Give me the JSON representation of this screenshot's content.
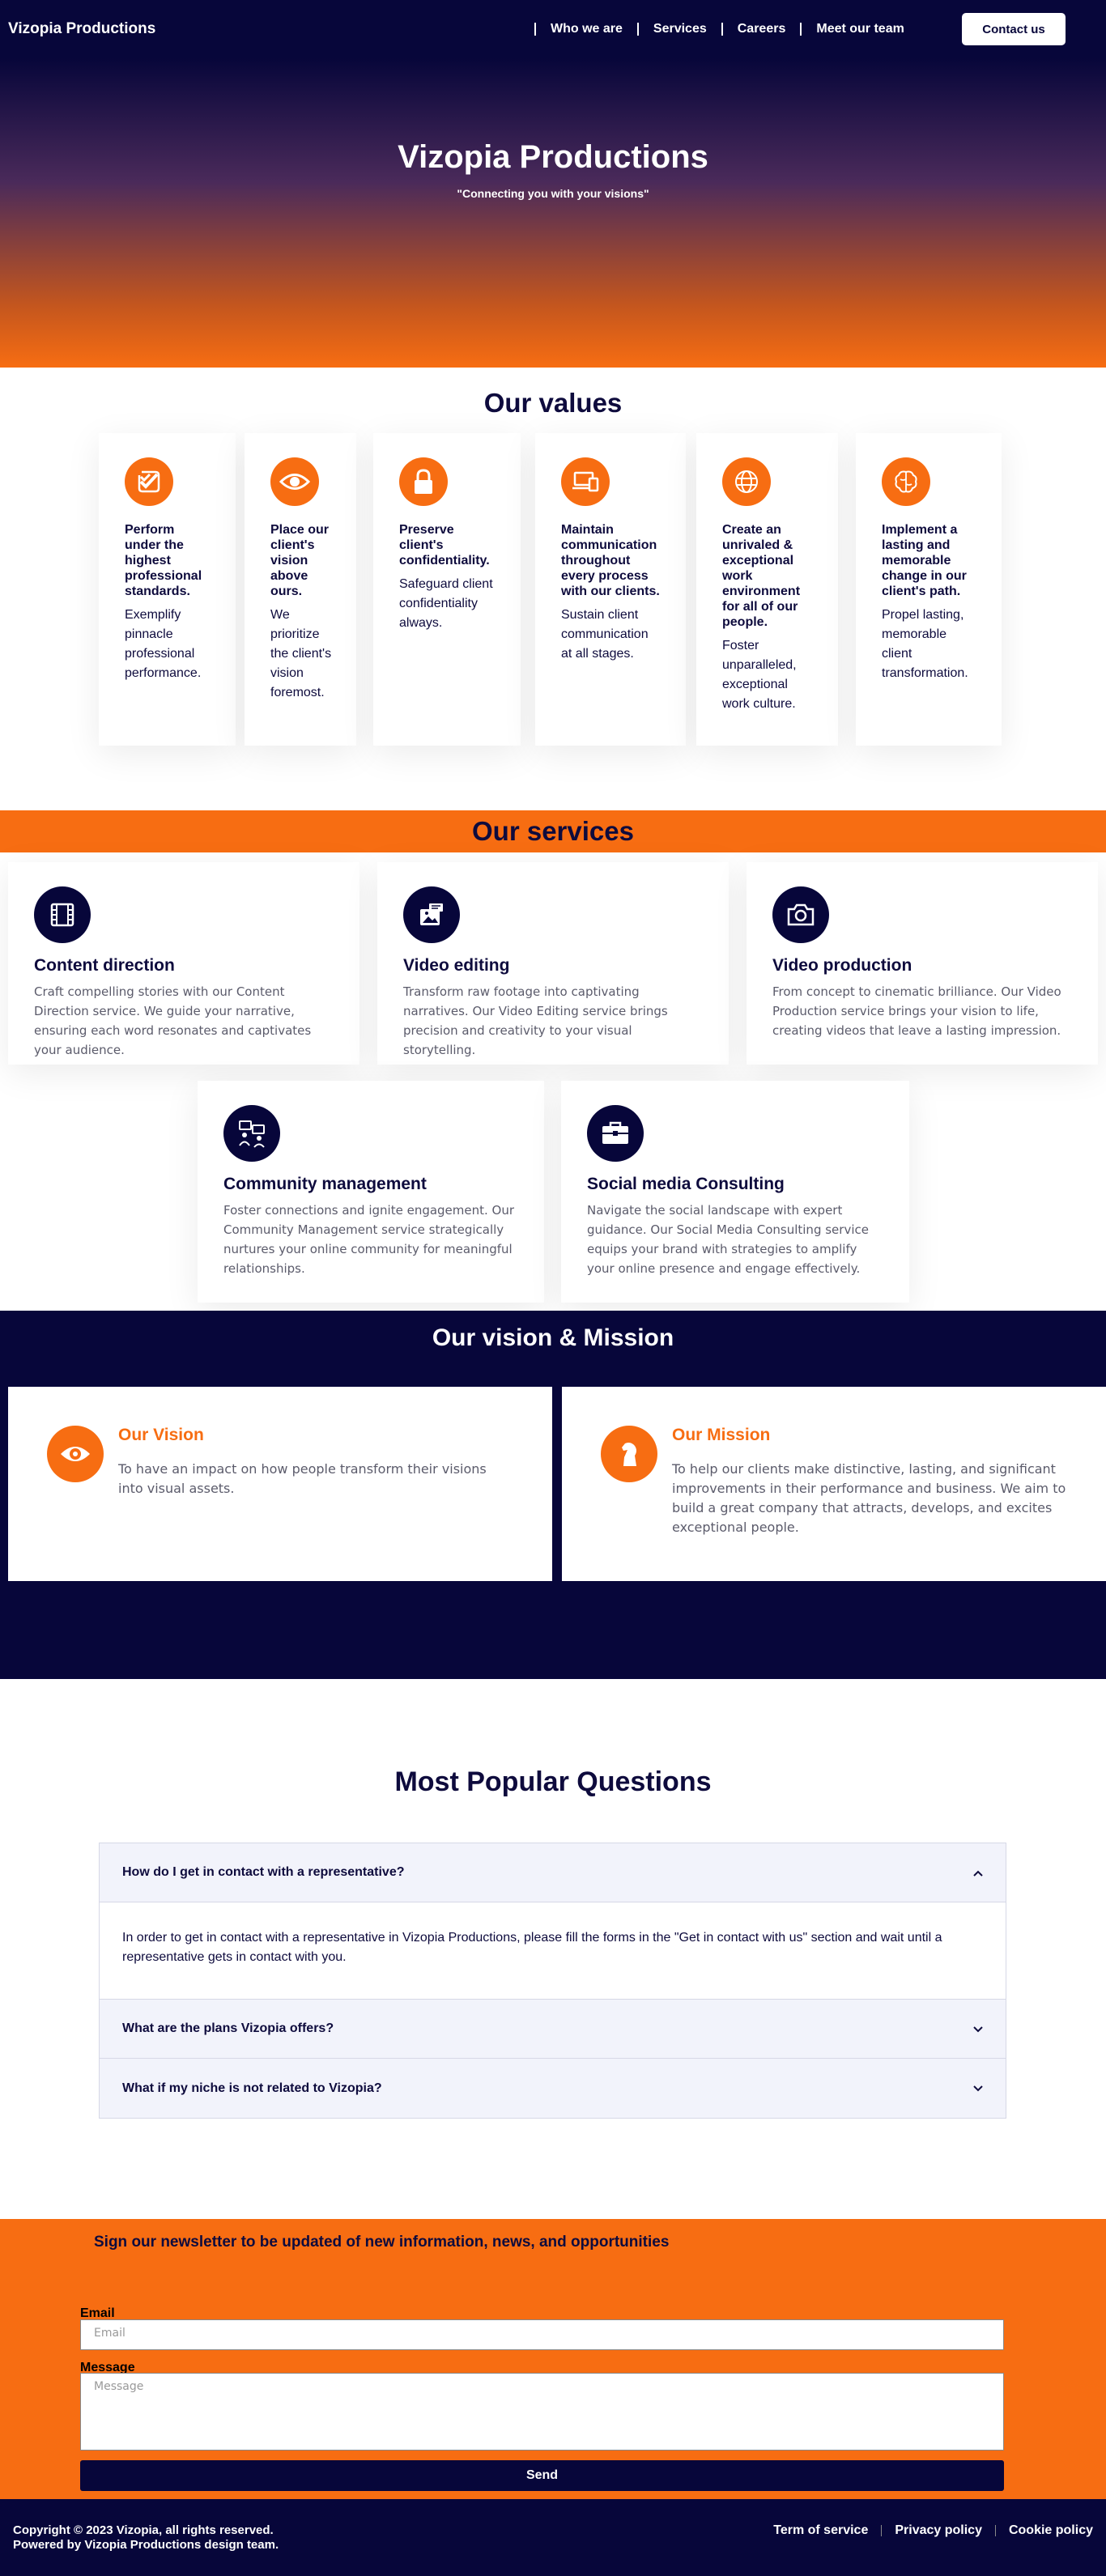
{
  "nav": {
    "brand": "Vizopia Productions",
    "links": [
      "Who we are",
      "Services",
      "Careers",
      "Meet our team"
    ],
    "contact_button": "Contact us"
  },
  "hero": {
    "title": "Vizopia Productions",
    "tagline": "\"Connecting you with your visions\""
  },
  "values": {
    "title": "Our values",
    "items": [
      {
        "icon": "double-check-icon",
        "heading": "Perform under the highest professional standards.",
        "text": "Exemplify pinnacle professional performance."
      },
      {
        "icon": "eye-icon",
        "heading": "Place our client's vision above ours.",
        "text": "We prioritize the client's vision foremost."
      },
      {
        "icon": "lock-icon",
        "heading": "Preserve client's confidentiality.",
        "text": "Safeguard client confidentiality always."
      },
      {
        "icon": "devices-icon",
        "heading": "Maintain communication throughout every process with our clients.",
        "text": "Sustain client communication at all stages."
      },
      {
        "icon": "globe-icon",
        "heading": "Create an unrivaled & exceptional work environment for all of our people.",
        "text": "Foster unparalleled, exceptional work culture."
      },
      {
        "icon": "brain-icon",
        "heading": "Implement a lasting and memorable change in our client's path.",
        "text": "Propel lasting, memorable client transformation."
      }
    ]
  },
  "services": {
    "title": "Our services",
    "items": [
      {
        "icon": "film-icon",
        "heading": "Content direction",
        "text": "Craft compelling stories with our Content Direction service. We guide your narrative, ensuring each word resonates and captivates your audience."
      },
      {
        "icon": "photo-edit-icon",
        "heading": "Video editing",
        "text": "Transform raw footage into captivating narratives. Our Video Editing service brings precision and creativity to your visual storytelling."
      },
      {
        "icon": "camera-icon",
        "heading": "Video production",
        "text": "From concept to cinematic brilliance. Our Video Production service brings your vision to life, creating videos that leave a lasting impression."
      },
      {
        "icon": "community-icon",
        "heading": "Community management",
        "text": "Foster connections and ignite engagement. Our Community Management service strategically nurtures your online community for meaningful relationships."
      },
      {
        "icon": "briefcase-icon",
        "heading": "Social media Consulting",
        "text": "Navigate the social landscape with expert guidance. Our Social Media Consulting service equips your brand with strategies to amplify your online presence and engage effectively."
      }
    ]
  },
  "vision": {
    "title": "Our vision & Mission",
    "vision_heading": "Our Vision",
    "vision_text": "To have an impact on how people transform their visions into visual assets.",
    "mission_heading": "Our Mission",
    "mission_text": "To help our clients make distinctive, lasting, and significant improvements in their performance and business. We aim to build a great company that attracts, develops, and excites exceptional people."
  },
  "faq": {
    "title": "Most Popular Questions",
    "items": [
      {
        "question": "How do I get in contact with a representative?",
        "answer": "In order to get in contact with a representative in Vizopia Productions, please fill the forms in the \"Get in contact with us\" section and wait until a representative gets in contact with you.",
        "expanded": true
      },
      {
        "question": "What are the plans Vizopia offers?",
        "expanded": false
      },
      {
        "question": "What if my niche is not related to Vizopia?",
        "expanded": false
      }
    ]
  },
  "newsletter": {
    "title": "Sign our newsletter to be updated of new information, news, and opportunities",
    "email_label": "Email",
    "email_placeholder": "Email",
    "message_label": "Message",
    "message_placeholder": "Message",
    "send_label": "Send"
  },
  "footer": {
    "copyright": "Copyright © 2023 Vizopia, all rights reserved.",
    "powered": "Powered by Vizopia Productions design team.",
    "links": [
      "Term of service",
      "Privacy policy",
      "Cookie policy"
    ]
  },
  "colors": {
    "navy": "#07063a",
    "orange": "#f76d12"
  }
}
